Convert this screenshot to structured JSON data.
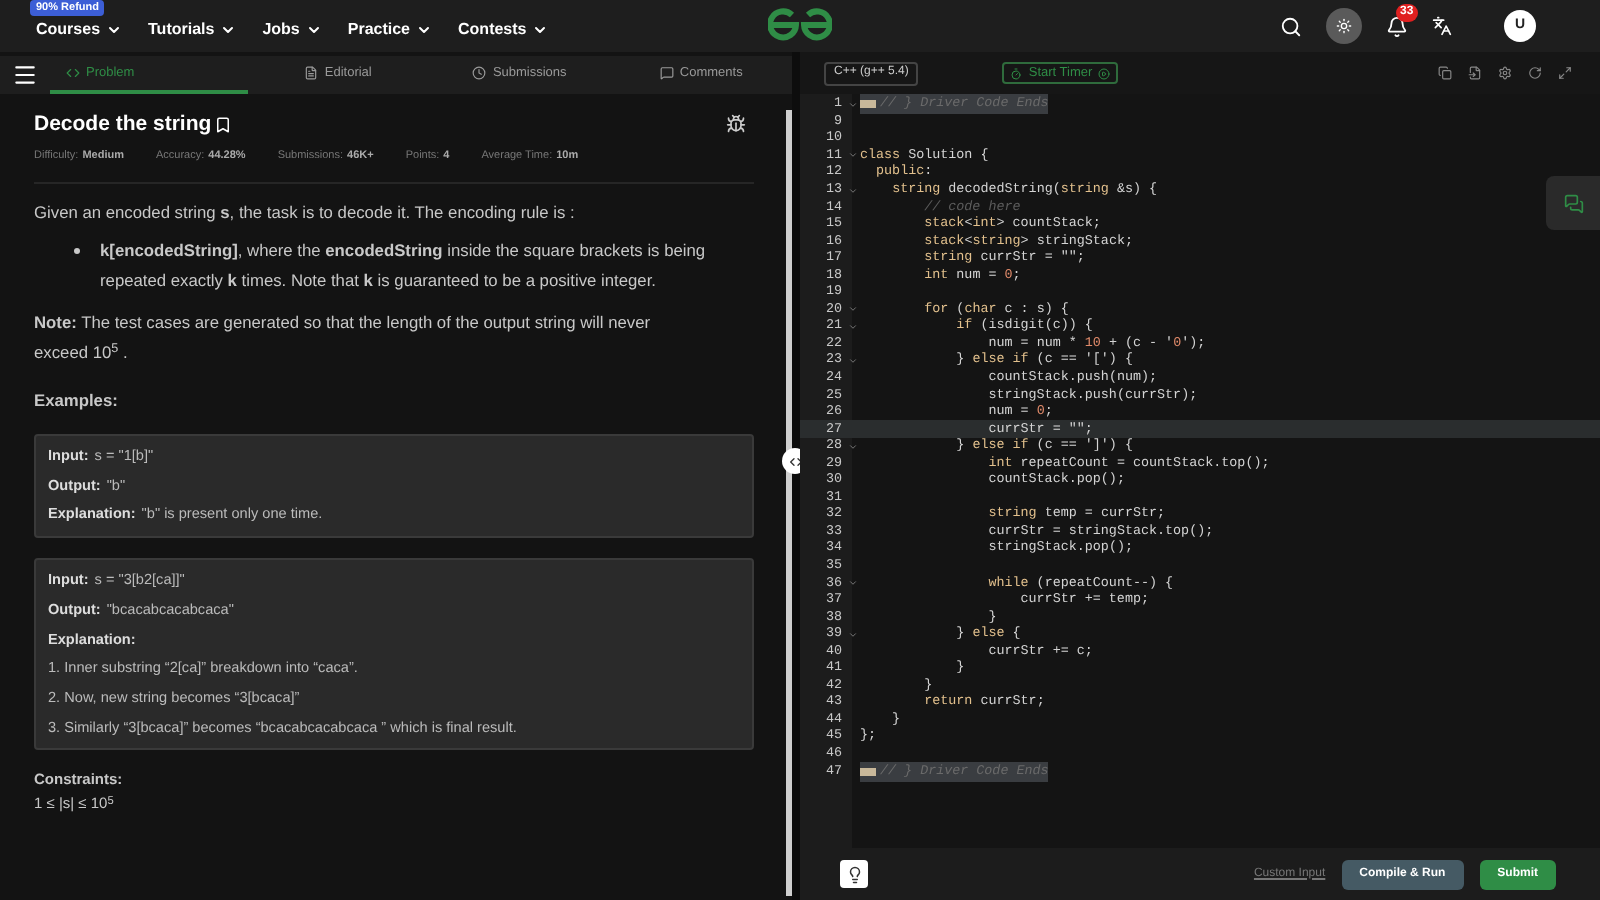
{
  "nav": {
    "badge": "90% Refund",
    "menus": [
      "Courses",
      "Tutorials",
      "Jobs",
      "Practice",
      "Contests"
    ],
    "notification_count": "33",
    "avatar": "U"
  },
  "tabs": [
    {
      "label": "Problem",
      "selected": true
    },
    {
      "label": "Editorial",
      "selected": false
    },
    {
      "label": "Submissions",
      "selected": false
    },
    {
      "label": "Comments",
      "selected": false
    }
  ],
  "problem": {
    "title": "Decode the string",
    "meta": [
      {
        "label": "Difficulty:",
        "value": "Medium"
      },
      {
        "label": "Accuracy:",
        "value": "44.28%"
      },
      {
        "label": "Submissions:",
        "value": "46K+"
      },
      {
        "label": "Points:",
        "value": "4"
      },
      {
        "label": "Average Time:",
        "value": "10m"
      }
    ],
    "intro": "Given an encoded string **s**, the task is to decode it. The encoding rule is :",
    "bullets": [
      "**k[encodedString]**, where the **encodedString** inside the square brackets is being repeated exactly **k** times. Note that **k** is guaranteed to be a positive integer."
    ],
    "note": "**Note:** The test cases are generated so that the length of the output string will never exceed 10$^{5}$ .",
    "examples_heading": "Examples:",
    "examples": [
      {
        "rows": [
          {
            "label": "Input:",
            "value": "s = \"1[b]\""
          },
          {
            "label": "Output:",
            "value": "\"b\""
          },
          {
            "label": "Explanation:",
            "value": "\"b\" is present only one time."
          }
        ]
      },
      {
        "rows": [
          {
            "label": "Input:",
            "value": "s = \"3[b2[ca]]\""
          },
          {
            "label": "Output:",
            "value": "\"bcacabcacabcaca\""
          },
          {
            "label": "Explanation:"
          }
        ],
        "steps": [
          "1. Inner substring “2[ca]” breakdown into “caca”.",
          "2. Now, new string becomes “3[bcaca]”",
          "3. Similarly “3[bcaca]” becomes “bcacabcacabcaca ” which is final result."
        ]
      }
    ],
    "constraints_heading": "Constraints:",
    "constraints": "1 ≤ |s| ≤ 10$^{5}$"
  },
  "editor": {
    "language": "C++ (g++ 5.4)",
    "timer": "Start Timer",
    "lines": [
      {
        "number": "1",
        "text": "// } Driver Code Ends",
        "kind": "folded",
        "fold": true,
        "current": false
      },
      {
        "number": "9",
        "kind": "code",
        "fold": false,
        "current": false
      },
      {
        "number": "10",
        "kind": "code",
        "fold": false,
        "current": false
      },
      {
        "number": "11",
        "text": "class Solution {",
        "kind": "code",
        "fold": true,
        "current": false
      },
      {
        "number": "12",
        "text": "  public:",
        "kind": "code",
        "fold": false,
        "current": false
      },
      {
        "number": "13",
        "text": "    string decodedString(string &s) {",
        "kind": "code",
        "fold": true,
        "current": false
      },
      {
        "number": "14",
        "text": "        // code here",
        "kind": "comment",
        "fold": false,
        "current": false
      },
      {
        "number": "15",
        "text": "        stack<int> countStack;",
        "kind": "code",
        "fold": false,
        "current": false
      },
      {
        "number": "16",
        "text": "        stack<string> stringStack;",
        "kind": "code",
        "fold": false,
        "current": false
      },
      {
        "number": "17",
        "text": "        string currStr = \"\";",
        "kind": "code",
        "fold": false,
        "current": false
      },
      {
        "number": "18",
        "text": "        int num = 0;",
        "kind": "code",
        "fold": false,
        "current": false
      },
      {
        "number": "19",
        "kind": "code",
        "fold": false,
        "current": false
      },
      {
        "number": "20",
        "text": "        for (char c : s) {",
        "kind": "code",
        "fold": true,
        "current": false
      },
      {
        "number": "21",
        "text": "            if (isdigit(c)) {",
        "kind": "code",
        "fold": true,
        "current": false
      },
      {
        "number": "22",
        "text": "                num = num * 10 + (c - '0');",
        "kind": "code",
        "fold": false,
        "current": false
      },
      {
        "number": "23",
        "text": "            } else if (c == '[') {",
        "kind": "code",
        "fold": true,
        "current": false
      },
      {
        "number": "24",
        "text": "                countStack.push(num);",
        "kind": "code",
        "fold": false,
        "current": false
      },
      {
        "number": "25",
        "text": "                stringStack.push(currStr);",
        "kind": "code",
        "fold": false,
        "current": false
      },
      {
        "number": "26",
        "text": "                num = 0;",
        "kind": "code",
        "fold": false,
        "current": false
      },
      {
        "number": "27",
        "text": "                currStr = \"\"; ",
        "kind": "code",
        "fold": false,
        "current": true
      },
      {
        "number": "28",
        "text": "            } else if (c == ']') {",
        "kind": "code",
        "fold": true,
        "current": false
      },
      {
        "number": "29",
        "text": "                int repeatCount = countStack.top();",
        "kind": "code",
        "fold": false,
        "current": false
      },
      {
        "number": "30",
        "text": "                countStack.pop();",
        "kind": "code",
        "fold": false,
        "current": false
      },
      {
        "number": "31",
        "kind": "code",
        "fold": false,
        "current": false
      },
      {
        "number": "32",
        "text": "                string temp = currStr;",
        "kind": "code",
        "fold": false,
        "current": false
      },
      {
        "number": "33",
        "text": "                currStr = stringStack.top();",
        "kind": "code",
        "fold": false,
        "current": false
      },
      {
        "number": "34",
        "text": "                stringStack.pop();",
        "kind": "code",
        "fold": false,
        "current": false
      },
      {
        "number": "35",
        "kind": "code",
        "fold": false,
        "current": false
      },
      {
        "number": "36",
        "text": "                while (repeatCount--) {",
        "kind": "code",
        "fold": true,
        "current": false
      },
      {
        "number": "37",
        "text": "                    currStr += temp;",
        "kind": "code",
        "fold": false,
        "current": false
      },
      {
        "number": "38",
        "text": "                }",
        "kind": "code",
        "fold": false,
        "current": false
      },
      {
        "number": "39",
        "text": "            } else {",
        "kind": "code",
        "fold": true,
        "current": false
      },
      {
        "number": "40",
        "text": "                currStr += c;",
        "kind": "code",
        "fold": false,
        "current": false
      },
      {
        "number": "41",
        "text": "            }",
        "kind": "code",
        "fold": false,
        "current": false
      },
      {
        "number": "42",
        "text": "        }",
        "kind": "code",
        "fold": false,
        "current": false
      },
      {
        "number": "43",
        "text": "        return currStr;",
        "kind": "code",
        "fold": false,
        "current": false
      },
      {
        "number": "44",
        "text": "    }",
        "kind": "code",
        "fold": false,
        "current": false
      },
      {
        "number": "45",
        "text": "};",
        "kind": "code",
        "fold": false,
        "current": false
      },
      {
        "number": "46",
        "kind": "code",
        "fold": false,
        "current": false
      },
      {
        "number": "47",
        "text": "// } Driver Code Ends",
        "kind": "folded",
        "fold": false,
        "current": false
      }
    ]
  },
  "footer": {
    "custom_input": "Custom Input",
    "compile": "Compile & Run",
    "submit": "Submit"
  }
}
